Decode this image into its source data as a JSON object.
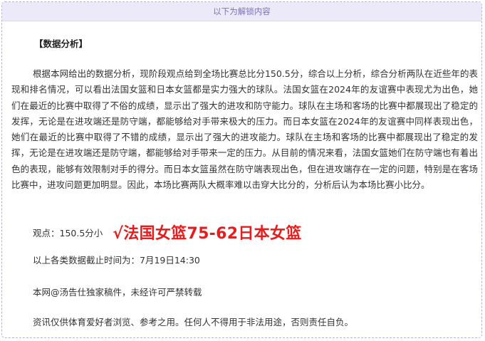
{
  "unlock_banner": {
    "text": "以下为解锁内容"
  },
  "article": {
    "section_title": "【数据分析】",
    "paragraph": "根据本网给出的数据分析，现阶段观点给到全场比赛总比分150.5分，综合以上分析，综合分析两队在近些年的表现和排名情况，可以看出法国女篮和日本女篮都是实力强大的球队。法国女篮在2024年的友谊赛中表现尤为出色，她们在最近的比赛中取得了不俗的成绩，显示出了强大的进攻和防守能力。球队在主场和客场的比赛中都展现出了稳定的发挥，无论是在进攻端还是防守端，都能够给对手带来极大的压力。而日本女篮在2024年的友谊赛中同样表现出色，她们在最近的比赛中取得了不错的成绩，显示出了强大的进攻能力。球队在主场和客场的比赛中都展现出了稳定的发挥，无论是在进攻端还是防守端，都能够给对手带来一定的压力。从目前的情况来看，法国女篮她们在防守端也有着出色的表现，能够有效限制对手的得分。而日本女篮虽然在防守端表现出色，但在进攻端存在一定的问题，特别是在客场比赛中，进攻问题更加明显。因此，本场比赛两队大概率难以击穿大比分的，分析后认为本场比赛小比分。",
    "viewpoint_label": "观点：150.5分小",
    "prediction": "√法国女篮75-62日本女篮",
    "data_cutoff": "以上各类数据截止时间为：7月19日14:30",
    "copyright": "本网@汤告仕独家稿件，未经许可严禁转载",
    "disclaimer": "资讯仅供体育爱好者浏览、参考之用。任何人不得用于非法用途，否则责任自负。"
  },
  "colors": {
    "prediction": "#e41e1e",
    "banner_background": "#eceaf8",
    "banner_text": "#7b72b8",
    "border": "#b7b2d4"
  }
}
